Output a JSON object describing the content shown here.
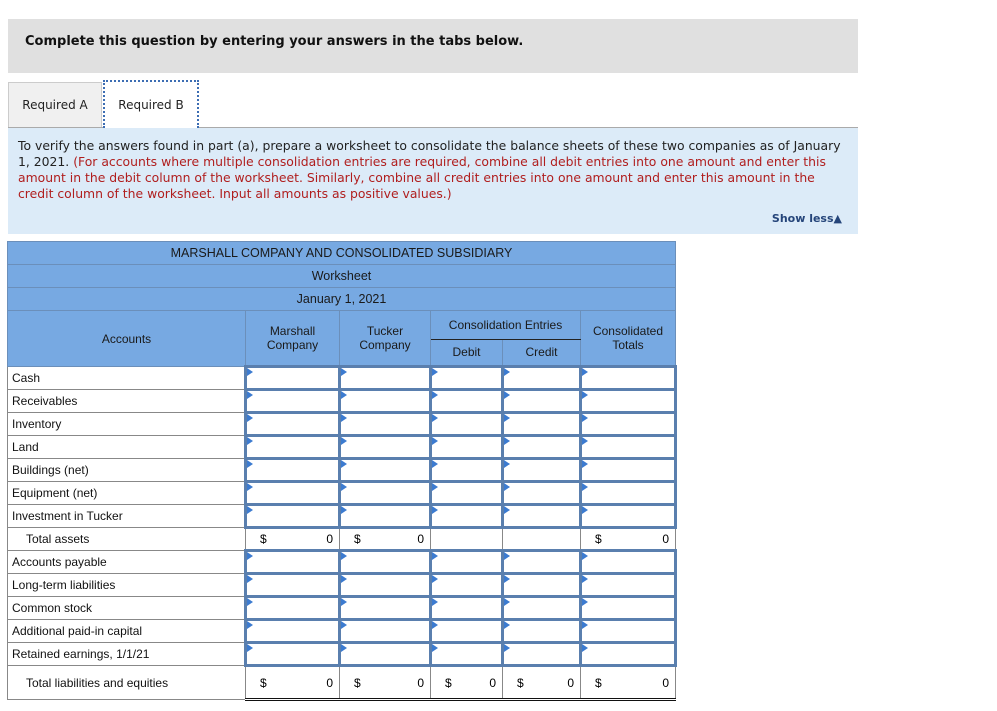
{
  "banner": {
    "text": "Complete this question by entering your answers in the tabs below."
  },
  "tabs": [
    {
      "label": "Required A",
      "active": false
    },
    {
      "label": "Required B",
      "active": true
    }
  ],
  "instructions": {
    "main": "To verify the answers found in part (a), prepare a worksheet to consolidate the balance sheets of these two companies as of January 1, 2021.",
    "note": "(For accounts where multiple consolidation entries are required, combine all debit entries into one amount and enter this amount in the debit column of the worksheet. Similarly, combine all credit entries into one amount and enter this amount in the credit column of the worksheet. Input all amounts as positive values.)",
    "show_less": "Show less"
  },
  "worksheet": {
    "title": "MARSHALL COMPANY AND CONSOLIDATED SUBSIDIARY",
    "subtitle": "Worksheet",
    "date": "January 1, 2021",
    "headers": {
      "accounts": "Accounts",
      "marshall": "Marshall Company",
      "tucker": "Tucker Company",
      "entries": "Consolidation Entries",
      "debit": "Debit",
      "credit": "Credit",
      "consolidated": "Consolidated Totals"
    },
    "asset_rows": [
      "Cash",
      "Receivables",
      "Inventory",
      "Land",
      "Buildings (net)",
      "Equipment (net)",
      "Investment in Tucker"
    ],
    "total_assets": {
      "label": "Total assets",
      "currency": "$",
      "marshall": "0",
      "tucker": "0",
      "consolidated": "0"
    },
    "liability_rows": [
      "Accounts payable",
      "Long-term liabilities",
      "Common stock",
      "Additional paid-in capital",
      "Retained earnings, 1/1/21"
    ],
    "total_liabilities": {
      "label": "Total liabilities and equities",
      "currency": "$",
      "marshall": "0",
      "tucker": "0",
      "debit": "0",
      "credit": "0",
      "consolidated": "0"
    }
  }
}
